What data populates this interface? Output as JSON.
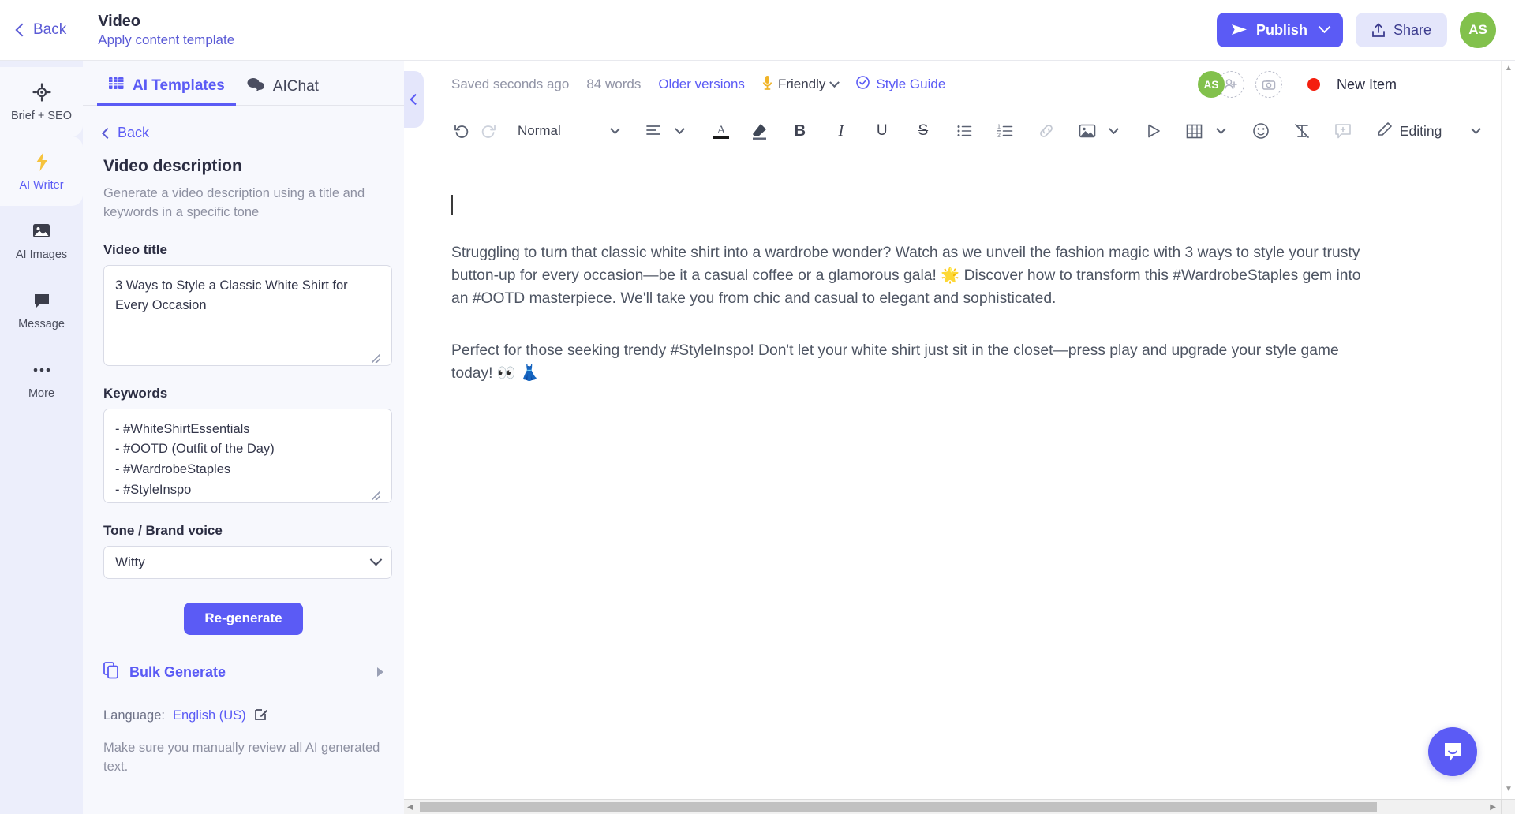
{
  "topbar": {
    "back_label": "Back",
    "title": "Video",
    "subtitle": "Apply content template",
    "publish_label": "Publish",
    "share_label": "Share",
    "avatar_initials": "AS",
    "accent_color": "#5b5bf5",
    "avatar_color": "#82c14c"
  },
  "rail": {
    "items": [
      {
        "label": "Brief + SEO",
        "icon": "target-icon",
        "active": false
      },
      {
        "label": "AI Writer",
        "icon": "lightning-icon",
        "active": true
      },
      {
        "label": "AI Images",
        "icon": "image-icon",
        "active": false
      },
      {
        "label": "Message",
        "icon": "chat-icon",
        "active": false
      },
      {
        "label": "More",
        "icon": "ellipsis-icon",
        "active": false
      }
    ]
  },
  "panel": {
    "tabs": [
      {
        "label": "AI Templates",
        "icon": "templates-icon",
        "active": true
      },
      {
        "label": "AIChat",
        "icon": "chat-bubbles-icon",
        "active": false
      }
    ],
    "back_label": "Back",
    "template_title": "Video description",
    "template_desc": "Generate a video description using a title and keywords in a specific tone",
    "fields": [
      {
        "label": "Video title",
        "value": "3 Ways to Style a Classic White Shirt for Every Occasion"
      },
      {
        "label": "Keywords",
        "value": "- #WhiteShirtEssentials\n- #OOTD (Outfit of the Day)\n- #WardrobeStaples\n- #StyleInspo"
      }
    ],
    "tone_label": "Tone / Brand voice",
    "tone_value": "Witty",
    "regenerate_label": "Re-generate",
    "bulk_generate_label": "Bulk Generate",
    "language_prefix": "Language:",
    "language_value": "English (US)",
    "disclaimer": "Make sure you manually review all AI generated text."
  },
  "editor": {
    "meta": {
      "saved": "Saved seconds ago",
      "words": "84 words",
      "older_versions": "Older versions",
      "tone": "Friendly",
      "style_guide": "Style Guide"
    },
    "collab": {
      "avatar_initials": "AS",
      "status_label": "New Item",
      "status_color": "#f41f0e"
    },
    "toolbar": {
      "undo": "undo-icon",
      "redo": "redo-icon",
      "paragraph_style": "Normal",
      "align": "align-icon",
      "text_color": "text-color-icon",
      "highlight": "highlight-icon",
      "bold": "B",
      "italic": "I",
      "underline": "U",
      "strike": "S",
      "bullet_list": "bullet-list-icon",
      "numbered_list": "numbered-list-icon",
      "link": "link-icon",
      "image": "image-icon",
      "video": "play-icon",
      "table": "table-icon",
      "emoji": "emoji-icon",
      "clear_format": "clear-format-icon",
      "comment": "comment-icon",
      "mode_label": "Editing",
      "more": "ellipsis-icon"
    },
    "document": {
      "paragraphs": [
        "Struggling to turn that classic white shirt into a wardrobe wonder? Watch as we unveil the fashion magic with 3 ways to style your trusty button-up for every occasion—be it a casual coffee or a glamorous gala! 🌟 Discover how to transform this #WardrobeStaples gem into an #OOTD masterpiece. We'll take you from chic and casual to elegant and sophisticated.",
        "Perfect for those seeking trendy #StyleInspo! Don't let your white shirt just sit in the closet—press play and upgrade your style game today! 👀 👗"
      ]
    }
  },
  "chat_widget": {
    "icon": "chat-bubble-icon"
  }
}
